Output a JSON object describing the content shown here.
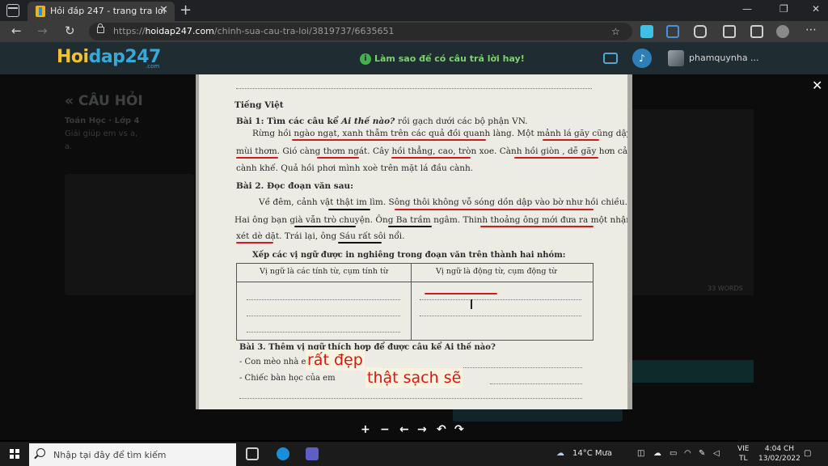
{
  "browser": {
    "tab_title": "Hỏi đáp 247 - trang tra loi",
    "tab_close": "✕",
    "new_tab": "+",
    "url_prefix": "https://",
    "url_domain": "hoidap247.com",
    "url_path": "/chinh-sua-cau-tra-loi/3819737/6635651",
    "window_minimize": "—",
    "window_maximize": "❐",
    "window_close": "✕"
  },
  "site": {
    "logo_part1": "Hoi",
    "logo_part2": "dap247",
    "logo_sub": ".com",
    "tip_icon": "i",
    "tip_text": "Làm sao để có câu trả lời hay!",
    "username": "phamquynha ..."
  },
  "background_page": {
    "title": "« CÂU HỎI",
    "subject": "Toán Học · Lớp 4",
    "question_line1": "Giải giúp em vs a,",
    "question_line2": "a.",
    "word_count": "33 WORDS"
  },
  "worksheet": {
    "section": "Tiếng Việt",
    "ex1_title": "Bài 1: Tìm các câu kể",
    "ex1_title_italic": "Ai thế nào?",
    "ex1_title_rest": "rồi gạch dưới các bộ phận VN.",
    "ex1_line1": "Rừng hồi ngào ngạt, xanh thẫm trên các quả đồi quanh làng. Một mảnh lá gãy cũng dậy",
    "ex1_line2": "mùi thơm. Gió càng thơm ngát. Cây hồi thẳng, cao, tròn xoe. Cành hồi giòn , dễ gãy hơn cả",
    "ex1_line3": "cành khế. Quả hồi phơi mình xoè trên mặt lá đầu cành.",
    "ex2_title": "Bài 2. Đọc đoạn văn sau:",
    "ex2_line1": "Về đêm, cảnh vật thật im lìm. Sông thôi không vỗ sóng dồn dập vào bờ như hồi chiều.",
    "ex2_line2": "Hai ông bạn già vẫn trò chuyện. Ông Ba trầm ngâm. Thinh thoảng ông mới đưa ra một nhận",
    "ex2_line3": "xét dè dặt. Trái lại, ông Sáu rất sôi nổi.",
    "ex2_task": "Xếp các vị ngữ được in nghiêng trong đoạn văn trên thành hai nhóm:",
    "table_col1": "Vị ngữ là các tính từ, cụm tính từ",
    "table_col2": "Vị ngữ là động từ, cụm động từ",
    "ex3_title": "Bài 3. Thêm vị ngữ thích hợp để được câu kể Ai thế nào?",
    "ex3_line1": "- Con mèo nhà em",
    "ex3_line2": "- Chiếc bàn học của em",
    "answer1": "rất đẹp",
    "answer2": "thật sạch sẽ"
  },
  "lightbox": {
    "close": "✕",
    "zoom_in": "+",
    "zoom_out": "−",
    "prev": "←",
    "next": "→",
    "rotate_left": "↶",
    "rotate_right": "↷"
  },
  "taskbar": {
    "search_placeholder": "Nhập tại đây để tìm kiếm",
    "weather": "14°C  Mưa",
    "lang_line1": "VIE",
    "lang_line2": "TL",
    "time": "4:04 CH",
    "date": "13/02/2022"
  },
  "colors": {
    "site_header": "#1f2d33",
    "logo_yellow": "#f2c12e",
    "logo_blue": "#35a9d9",
    "tip_green": "#7fd16f",
    "answer_red": "#e0140f",
    "underline_red": "#d11a1a"
  }
}
